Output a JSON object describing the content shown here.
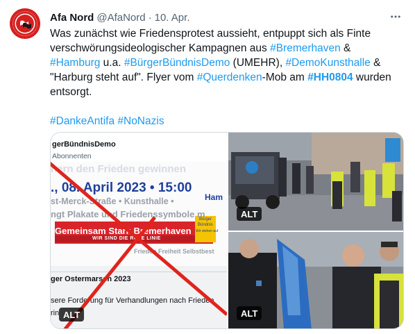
{
  "author": {
    "name": "Afa Nord",
    "handle": "@AfaNord",
    "separator": "·",
    "date": "10. Apr.",
    "avatar_icon": "antifa-flag-logo",
    "avatar_ring_text": "ANTIFASCHISTISCHE AKTION"
  },
  "more_icon": "more-horizontal-icon",
  "tweet": {
    "l1": "Was zunächst wie Friedensprotest aussieht, entpuppt sich als Finte",
    "l2_pre": "verschwörungsideologischer Kampagnen aus ",
    "l2_tag": "#Bremerhaven",
    "l2_post": " &",
    "l3_tag1": "#Hamburg",
    "l3_mid1": " u.a. ",
    "l3_tag2": "#BürgerBündnisDemo",
    "l3_mid2": " (UMEHR), ",
    "l3_tag3": "#DemoKunsthalle",
    "l3_post": " &",
    "l4_pre": "\"Harburg steht auf\". Flyer vom ",
    "l4_tag1": "#Querdenken",
    "l4_mid": "-Mob am ",
    "l4_tag2": "#HH0804",
    "l4_post": " wurden",
    "l5": "entsorgt.",
    "l7_tag1": "#DankeAntifa",
    "l7_space": " ",
    "l7_tag2": "#NoNazis"
  },
  "media": {
    "alt_label": "ALT",
    "flyer": {
      "account": "gerBündnisDemo",
      "followers": "Abonnenten",
      "headline": "hern den Frieden gewinnen",
      "date_line": "., 08. April 2023 • 15:00",
      "ham": "Ham",
      "street": "st-Merck-Straße • Kunsthalle •",
      "plakate": "ngt Plakate und Friedenssymbole m",
      "banner": "Gemeinsam Stark Bremerhaven",
      "banner_sub": "WIR SIND DIE ROTE LINIE",
      "sticker1": "Bürger",
      "sticker2": "Bündnis",
      "sticker3": "Wir stehen auf",
      "frieden": "Frieden Freiheit Selbstbest",
      "ostermarsch": "ger Ostermarsch 2023",
      "forderung": "sere Forderung für Verhandlungen nach Frieden",
      "rin": "rin"
    },
    "colors": {
      "accent": "#1d9bf0",
      "flyer_blue": "#1e3f9e",
      "flyer_red": "#d9242b",
      "cross": "#e0241c"
    }
  }
}
